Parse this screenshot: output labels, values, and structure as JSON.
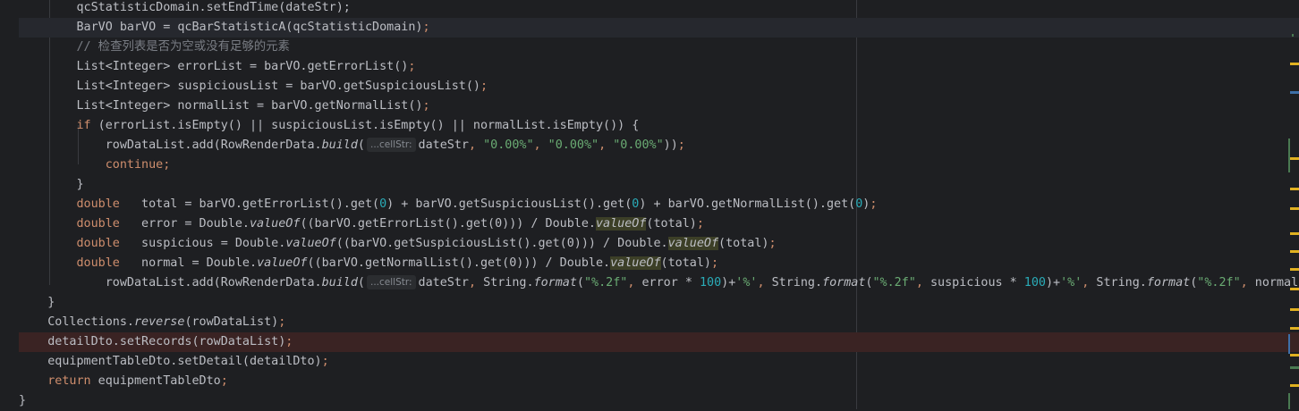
{
  "editor": {
    "lines": [
      [
        {
          "t": "        qcStatisticDomain.setEndTime(dateStr);"
        }
      ],
      [
        {
          "t": "        BarVO barVO = qcBarStatisticA(qcStatisticDomain)"
        },
        {
          "t": ";",
          "c": "kw"
        }
      ],
      [
        {
          "t": "        // 检查列表是否为空或没有足够的元素",
          "c": "cmt"
        }
      ],
      [
        {
          "t": "        List<Integer> errorList = barVO.getErrorList()"
        },
        {
          "t": ";",
          "c": "kw"
        }
      ],
      [
        {
          "t": "        List<Integer> suspiciousList = barVO.getSuspiciousList()"
        },
        {
          "t": ";",
          "c": "kw"
        }
      ],
      [
        {
          "t": "        List<Integer> normalList = barVO.getNormalList()"
        },
        {
          "t": ";",
          "c": "kw"
        }
      ],
      [
        {
          "t": "        "
        },
        {
          "t": "if",
          "c": "kw"
        },
        {
          "t": " (errorList.isEmpty() || suspiciousList.isEmpty() || normalList.isEmpty()) {"
        }
      ],
      [
        {
          "t": "            rowDataList.add(RowRenderData."
        },
        {
          "t": "build",
          "c": "it"
        },
        {
          "t": "("
        },
        {
          "hint": "...cellStr:"
        },
        {
          "t": "dateStr"
        },
        {
          "t": ", ",
          "c": "kw"
        },
        {
          "t": "\"0.00%\"",
          "c": "str"
        },
        {
          "t": ", ",
          "c": "kw"
        },
        {
          "t": "\"0.00%\"",
          "c": "str"
        },
        {
          "t": ", ",
          "c": "kw"
        },
        {
          "t": "\"0.00%\"",
          "c": "str"
        },
        {
          "t": "))"
        },
        {
          "t": ";",
          "c": "kw"
        }
      ],
      [
        {
          "t": "            "
        },
        {
          "t": "continue;",
          "c": "kw"
        }
      ],
      [
        {
          "t": "        }"
        }
      ],
      [
        {
          "t": "        "
        },
        {
          "t": "double",
          "c": "kw"
        },
        {
          "t": "   total = barVO.getErrorList().get("
        },
        {
          "t": "0",
          "c": "num"
        },
        {
          "t": ") + barVO.getSuspiciousList().get("
        },
        {
          "t": "0",
          "c": "num"
        },
        {
          "t": ") + barVO.getNormalList().get("
        },
        {
          "t": "0",
          "c": "num"
        },
        {
          "t": ")"
        },
        {
          "t": ";",
          "c": "kw"
        }
      ],
      [
        {
          "t": "        "
        },
        {
          "t": "double",
          "c": "kw"
        },
        {
          "t": "   error = Double."
        },
        {
          "t": "valueOf",
          "c": "it"
        },
        {
          "t": "((barVO.getErrorList().get(0))) / Double."
        },
        {
          "t": "valueOf",
          "c": "it occ"
        },
        {
          "t": "(total)"
        },
        {
          "t": ";",
          "c": "kw"
        }
      ],
      [
        {
          "t": "        "
        },
        {
          "t": "double",
          "c": "kw"
        },
        {
          "t": "   suspicious = Double."
        },
        {
          "t": "valueOf",
          "c": "it"
        },
        {
          "t": "((barVO.getSuspiciousList().get(0))) / Double."
        },
        {
          "t": "valueOf",
          "c": "it occ"
        },
        {
          "t": "(total)"
        },
        {
          "t": ";",
          "c": "kw"
        }
      ],
      [
        {
          "t": "        "
        },
        {
          "t": "double",
          "c": "kw"
        },
        {
          "t": "   normal = Double."
        },
        {
          "t": "valueOf",
          "c": "it"
        },
        {
          "t": "((barVO.getNormalList().get(0))) / Double."
        },
        {
          "t": "valueOf",
          "c": "it occ"
        },
        {
          "t": "(total)"
        },
        {
          "t": ";",
          "c": "kw"
        }
      ],
      [
        {
          "t": "            rowDataList.add(RowRenderData."
        },
        {
          "t": "build",
          "c": "it"
        },
        {
          "t": "("
        },
        {
          "hint": "...cellStr:"
        },
        {
          "t": "dateStr"
        },
        {
          "t": ", ",
          "c": "kw"
        },
        {
          "t": "String."
        },
        {
          "t": "format",
          "c": "it"
        },
        {
          "t": "("
        },
        {
          "t": "\"%.2f\"",
          "c": "str"
        },
        {
          "t": ", ",
          "c": "kw"
        },
        {
          "t": "error * "
        },
        {
          "t": "100",
          "c": "num"
        },
        {
          "t": ")+"
        },
        {
          "t": "'%'",
          "c": "str"
        },
        {
          "t": ", ",
          "c": "kw"
        },
        {
          "t": "String."
        },
        {
          "t": "format",
          "c": "it"
        },
        {
          "t": "("
        },
        {
          "t": "\"%.2f\"",
          "c": "str"
        },
        {
          "t": ", ",
          "c": "kw"
        },
        {
          "t": "suspicious * "
        },
        {
          "t": "100",
          "c": "num"
        },
        {
          "t": ")+"
        },
        {
          "t": "'%'",
          "c": "str"
        },
        {
          "t": ", ",
          "c": "kw"
        },
        {
          "t": "String."
        },
        {
          "t": "format",
          "c": "it"
        },
        {
          "t": "("
        },
        {
          "t": "\"%.2f\"",
          "c": "str"
        },
        {
          "t": ", ",
          "c": "kw"
        },
        {
          "t": "normal"
        }
      ],
      [
        {
          "t": "    }"
        }
      ],
      [
        {
          "t": "    Collections."
        },
        {
          "t": "reverse",
          "c": "it"
        },
        {
          "t": "(rowDataList)"
        },
        {
          "t": ";",
          "c": "kw"
        }
      ],
      [
        {
          "t": "    detailDto.setRecords(rowDataList)"
        },
        {
          "t": ";",
          "c": "kw"
        }
      ],
      [
        {
          "t": "    equipmentTableDto.setDetail(detailDto)"
        },
        {
          "t": ";",
          "c": "kw"
        }
      ],
      [
        {
          "t": "    "
        },
        {
          "t": "return",
          "c": "kw"
        },
        {
          "t": " equipmentTableDto"
        },
        {
          "t": ";",
          "c": "kw"
        }
      ],
      [
        {
          "t": "}"
        }
      ]
    ]
  },
  "colors": {
    "background": "#1e1f22",
    "keyword": "#cf8e6d",
    "string": "#6aab73",
    "number": "#2aacb8",
    "comment": "#7a7e85",
    "text": "#bcbec4",
    "marker_warning": "#e0b020",
    "marker_change": "#4a7a52",
    "marker_info": "#3e6fa8",
    "marker_error": "#8a3a3a"
  }
}
